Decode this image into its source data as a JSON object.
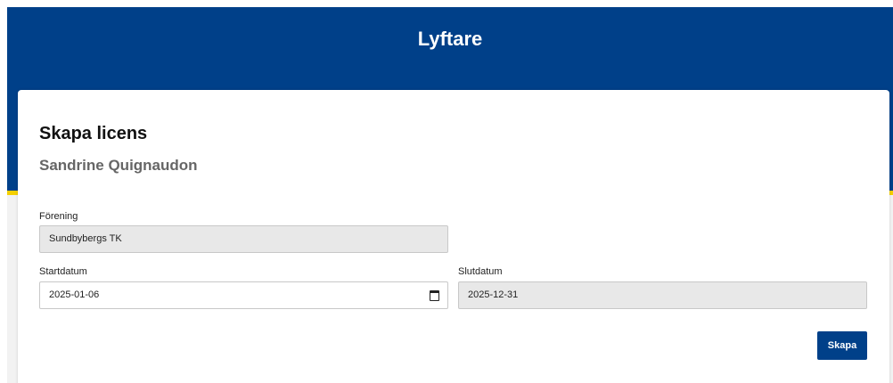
{
  "header": {
    "title": "Lyftare"
  },
  "card": {
    "title": "Skapa licens",
    "subtitle": "Sandrine Quignaudon"
  },
  "form": {
    "club": {
      "label": "Förening",
      "value": "Sundbybergs TK"
    },
    "start_date": {
      "label": "Startdatum",
      "value": "2025-01-06",
      "icon": "calendar-icon"
    },
    "end_date": {
      "label": "Slutdatum",
      "value": "2025-12-31"
    },
    "submit_label": "Skapa"
  },
  "colors": {
    "brand_blue": "#004089",
    "accent_yellow": "#f5d000",
    "readonly_field": "#e8e8e8"
  }
}
